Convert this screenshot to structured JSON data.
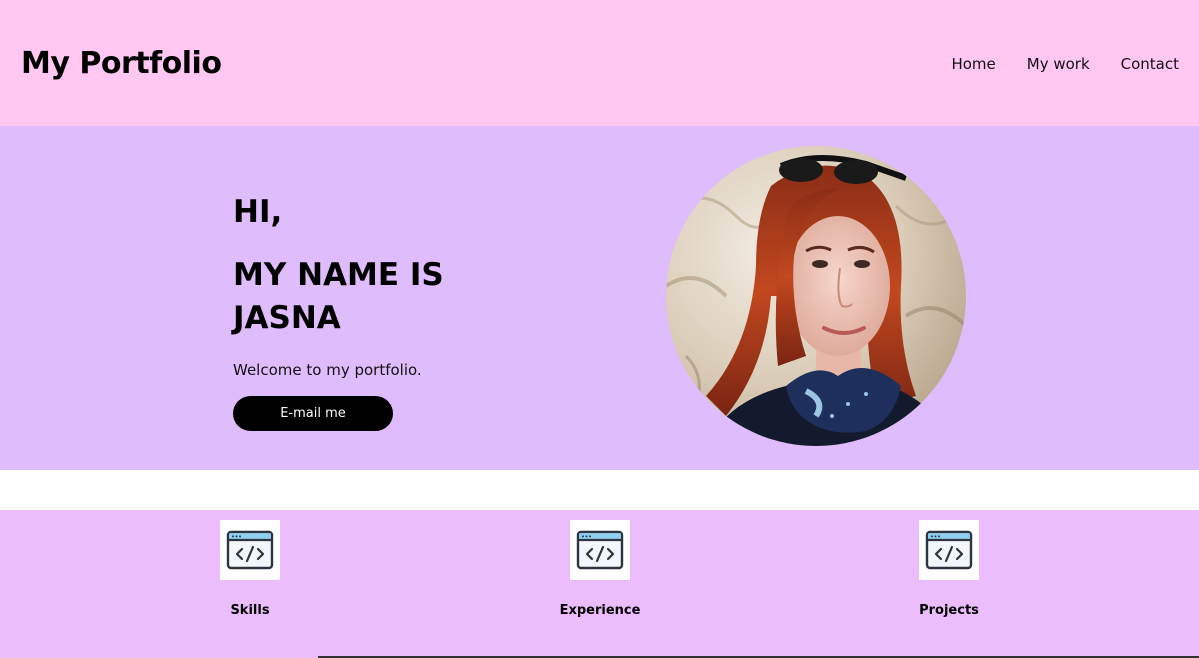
{
  "header": {
    "title": "My Portfolio",
    "nav": [
      "Home",
      "My work",
      "Contact"
    ]
  },
  "hero": {
    "greeting": "HI,",
    "name_line": "MY NAME IS JASNA",
    "welcome": "Welcome to my portfolio.",
    "button_label": "E-mail me"
  },
  "cards": [
    {
      "label": "Skills",
      "icon": "code-window-icon"
    },
    {
      "label": "Experience",
      "icon": "code-window-icon"
    },
    {
      "label": "Projects",
      "icon": "code-window-icon"
    }
  ],
  "colors": {
    "header_bg": "#ffc7f2",
    "hero_bg": "#dfbcfc",
    "cards_bg": "#ebbdfc",
    "button_bg": "#000000"
  }
}
